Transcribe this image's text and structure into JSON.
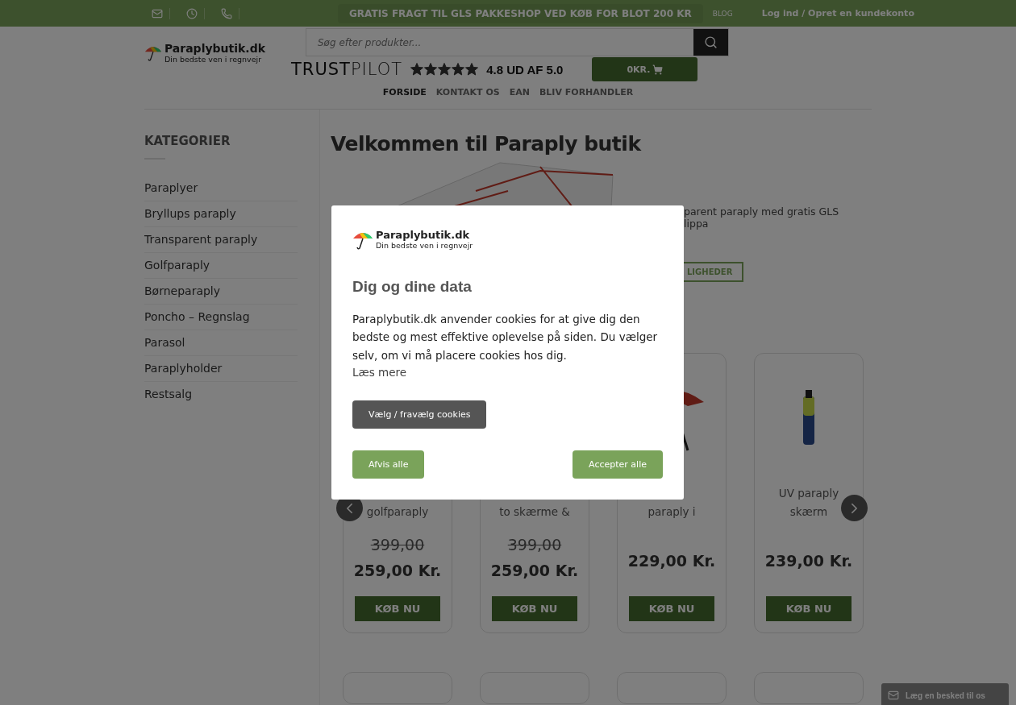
{
  "top_bar": {
    "promo": "GRATIS FRAGT TIL GLS PAKKESHOP VED KØB FOR BLOT 200 KR",
    "blog": "BLOG",
    "login": "Log ind / Opret en kundekonto"
  },
  "header": {
    "logo": {
      "name": "Paraplybutik.dk",
      "tagline": "Din bedste ven i regnvejr"
    },
    "search": {
      "placeholder": "Søg efter produkter..."
    },
    "trustpilot": {
      "brand": "**TRUST**PILOT",
      "stars": 5,
      "rating": "4.8 UD AF 5.0"
    },
    "cart": "0KR."
  },
  "nav": [
    {
      "label": "FORSIDE",
      "selected": true
    },
    {
      "label": "KONTAKT OS",
      "selected": false
    },
    {
      "label": "EAN",
      "selected": false
    },
    {
      "label": "BLIV FORHANDLER",
      "selected": false
    }
  ],
  "sidebar": {
    "title": "KATEGORIER",
    "items": [
      "Paraplyer",
      "Bryllups paraply",
      "Transparent paraply",
      "Golfparaply",
      "Børneparaply",
      "Poncho – Regnslag",
      "Parasol",
      "Paraplyholder",
      "Restsalg"
    ]
  },
  "main": {
    "title": "Velkommen til Paraply butik",
    "intro_lines": [
      "parent paraply med gratis GLS",
      "lippa"
    ],
    "intro_button": "LIGHEDER",
    "products": [
      {
        "name_lines": [
          "golfparaply"
        ],
        "old_price": "399,00",
        "price": "259,00 Kr.",
        "button": "KØB NU"
      },
      {
        "name_lines": [
          "to skærme &"
        ],
        "old_price": "399,00",
        "price": "259,00 Kr.",
        "button": "KØB NU"
      },
      {
        "kind": "open",
        "name_lines": [
          "paraply i"
        ],
        "price": "229,00 Kr.",
        "button": "KØB NU"
      },
      {
        "kind": "folded",
        "name_lines": [
          "UV paraply",
          "skærm"
        ],
        "price": "239,00 Kr.",
        "button": "KØB NU"
      }
    ]
  },
  "modal": {
    "logo": {
      "name": "Paraplybutik.dk",
      "tagline": "Din bedste ven i regnvejr"
    },
    "heading": "Dig og dine data",
    "body": "Paraplybutik.dk anvender cookies for at give dig den bedste og mest effektive oplevelse på siden. Du vælger selv, om vi må placere cookies hos dig.",
    "link": "Læs mere",
    "settings_button": "Vælg / fravælg cookies",
    "reject_button": "Afvis alle",
    "accept_button": "Accepter alle"
  },
  "chat": {
    "label": "Læg en besked til os"
  }
}
